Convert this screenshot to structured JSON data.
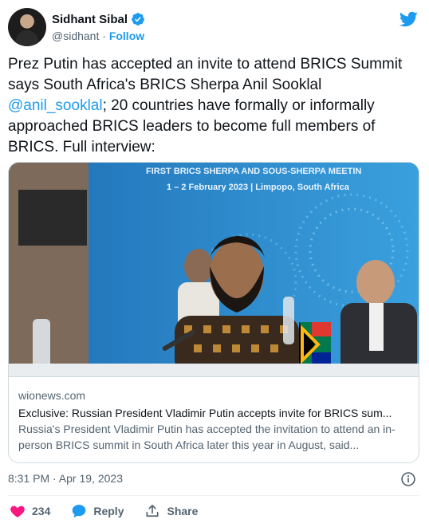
{
  "author": {
    "display_name": "Sidhant Sibal",
    "handle": "@sidhant",
    "separator": "·",
    "follow_label": "Follow"
  },
  "tweet": {
    "text_before_mention": "Prez Putin has accepted an invite to attend BRICS Summit says South Africa's BRICS Sherpa Anil Sooklal ",
    "mention": "@anil_sooklal",
    "text_after_mention": "; 20 countries have formally or informally approached BRICS leaders to become full members of BRICS. Full interview:"
  },
  "card": {
    "image_banner_line1": "FIRST BRICS SHERPA AND SOUS-SHERPA MEETIN",
    "image_banner_line2": "1 – 2 February 2023  |  Limpopo, South Africa",
    "domain": "wionews.com",
    "title": "Exclusive: Russian President Vladimir Putin accepts invite for BRICS sum...",
    "description": "Russia's President Vladimir Putin has accepted the invitation to attend an in-person BRICS summit in South Africa later this year in August, said..."
  },
  "meta": {
    "timestamp": "8:31 PM · Apr 19, 2023"
  },
  "actions": {
    "like_count": "234",
    "reply_label": "Reply",
    "share_label": "Share"
  },
  "colors": {
    "accent": "#1d9bf0",
    "like": "#f91880",
    "secondary_text": "#536471"
  },
  "icons": [
    "verified-badge-icon",
    "twitter-bird-icon",
    "info-icon",
    "heart-icon",
    "reply-bubble-icon",
    "share-icon"
  ]
}
